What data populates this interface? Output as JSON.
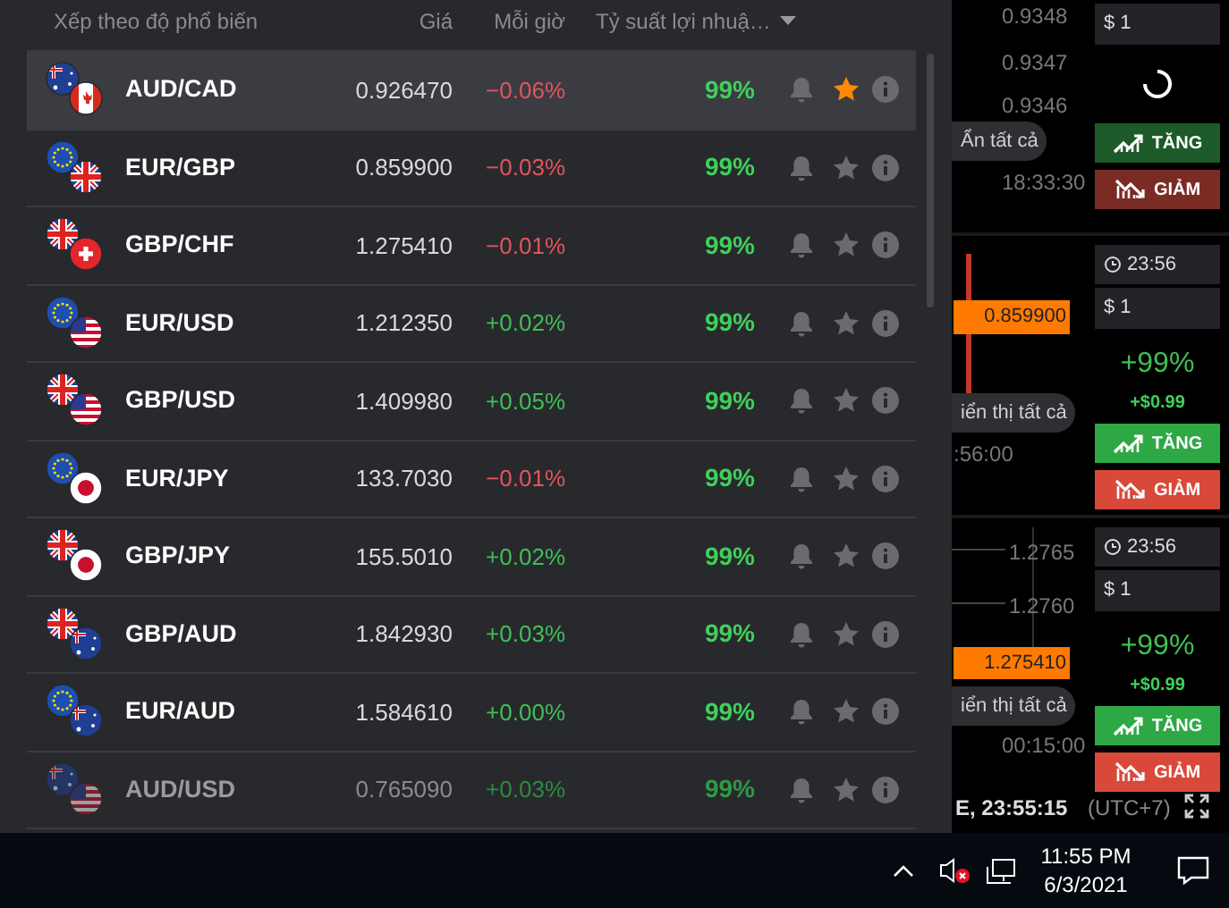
{
  "list_header": {
    "sort_label": "Xếp theo độ phổ biến",
    "columns": [
      "Giá",
      "Mỗi giờ",
      "Tỷ suất lợi nhuậ…"
    ]
  },
  "assets": [
    {
      "name": "AUD/CAD",
      "price": "0.926470",
      "change": "−0.06%",
      "rising": false,
      "profit": "99%",
      "favorite": true,
      "selected": true,
      "dimmed": false,
      "flags": [
        {
          "kind": "au"
        },
        {
          "kind": "ca"
        }
      ]
    },
    {
      "name": "EUR/GBP",
      "price": "0.859900",
      "change": "−0.03%",
      "rising": false,
      "profit": "99%",
      "favorite": false,
      "selected": false,
      "dimmed": false,
      "flags": [
        {
          "kind": "eu"
        },
        {
          "kind": "gb"
        }
      ]
    },
    {
      "name": "GBP/CHF",
      "price": "1.275410",
      "change": "−0.01%",
      "rising": false,
      "profit": "99%",
      "favorite": false,
      "selected": false,
      "dimmed": false,
      "flags": [
        {
          "kind": "gb"
        },
        {
          "kind": "ch"
        }
      ]
    },
    {
      "name": "EUR/USD",
      "price": "1.212350",
      "change": "+0.02%",
      "rising": true,
      "profit": "99%",
      "favorite": false,
      "selected": false,
      "dimmed": false,
      "flags": [
        {
          "kind": "eu"
        },
        {
          "kind": "us"
        }
      ]
    },
    {
      "name": "GBP/USD",
      "price": "1.409980",
      "change": "+0.05%",
      "rising": true,
      "profit": "99%",
      "favorite": false,
      "selected": false,
      "dimmed": false,
      "flags": [
        {
          "kind": "gb"
        },
        {
          "kind": "us"
        }
      ]
    },
    {
      "name": "EUR/JPY",
      "price": "133.7030",
      "change": "−0.01%",
      "rising": false,
      "profit": "99%",
      "favorite": false,
      "selected": false,
      "dimmed": false,
      "flags": [
        {
          "kind": "eu"
        },
        {
          "kind": "jp"
        }
      ]
    },
    {
      "name": "GBP/JPY",
      "price": "155.5010",
      "change": "+0.02%",
      "rising": true,
      "profit": "99%",
      "favorite": false,
      "selected": false,
      "dimmed": false,
      "flags": [
        {
          "kind": "gb"
        },
        {
          "kind": "jp"
        }
      ]
    },
    {
      "name": "GBP/AUD",
      "price": "1.842930",
      "change": "+0.03%",
      "rising": true,
      "profit": "99%",
      "favorite": false,
      "selected": false,
      "dimmed": false,
      "flags": [
        {
          "kind": "gb"
        },
        {
          "kind": "au"
        }
      ]
    },
    {
      "name": "EUR/AUD",
      "price": "1.584610",
      "change": "+0.00%",
      "rising": true,
      "profit": "99%",
      "favorite": false,
      "selected": false,
      "dimmed": false,
      "flags": [
        {
          "kind": "eu"
        },
        {
          "kind": "au"
        }
      ]
    },
    {
      "name": "AUD/USD",
      "price": "0.765090",
      "change": "+0.03%",
      "rising": true,
      "profit": "99%",
      "favorite": false,
      "selected": false,
      "dimmed": true,
      "flags": [
        {
          "kind": "au"
        },
        {
          "kind": "us"
        }
      ]
    }
  ],
  "charts": [
    {
      "axis_labels": [
        "0.9348",
        "0.9347",
        "0.9346"
      ],
      "pill": "Ẩn tất cả",
      "time": "18:33:30"
    },
    {
      "price_tag": "0.859900",
      "pill": "iển thị tất cả",
      "time": ":56:00"
    },
    {
      "axis_labels": [
        "1.2765",
        "1.2760"
      ],
      "price_tag": "1.275410",
      "pill": "iển thị tất cả",
      "time": "00:15:00"
    }
  ],
  "trade_panels": [
    {
      "amount": "$ 1",
      "loading": true,
      "up_label": "TĂNG",
      "down_label": "GIẢM"
    },
    {
      "time": "23:56",
      "amount": "$ 1",
      "payout": "+99%",
      "profit": "+$0.99",
      "up_label": "TĂNG",
      "down_label": "GIẢM"
    },
    {
      "time": "23:56",
      "amount": "$ 1",
      "payout": "+99%",
      "profit": "+$0.99",
      "up_label": "TĂNG",
      "down_label": "GIẢM"
    }
  ],
  "footer": {
    "server_time": "E, 23:55:15",
    "timezone": "(UTC+7)"
  },
  "taskbar": {
    "time": "11:55 PM",
    "date": "6/3/2021"
  }
}
